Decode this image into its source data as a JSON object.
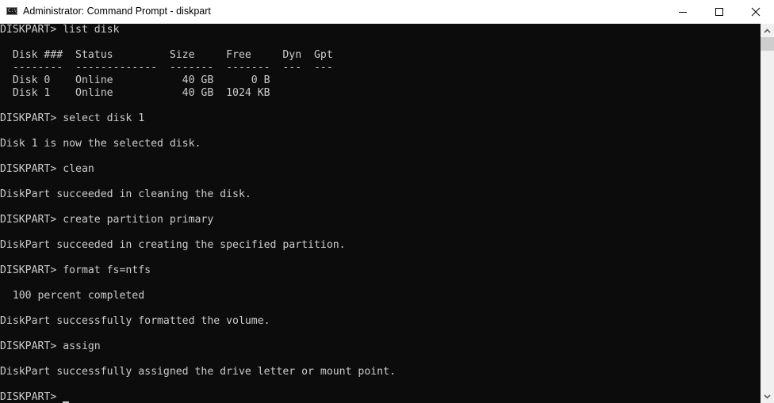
{
  "window": {
    "title": "Administrator: Command Prompt - diskpart",
    "icon": "cmd-icon",
    "icon_text": "C:\\.",
    "controls": [
      "minimize-icon",
      "maximize-icon",
      "close-icon"
    ]
  },
  "console": {
    "background": "#0c0c0c",
    "foreground": "#cccccc",
    "lines": [
      "DISKPART> list disk",
      "",
      "  Disk ###  Status         Size     Free     Dyn  Gpt",
      "  --------  -------------  -------  -------  ---  ---",
      "  Disk 0    Online           40 GB      0 B",
      "  Disk 1    Online           40 GB  1024 KB",
      "",
      "DISKPART> select disk 1",
      "",
      "Disk 1 is now the selected disk.",
      "",
      "DISKPART> clean",
      "",
      "DiskPart succeeded in cleaning the disk.",
      "",
      "DISKPART> create partition primary",
      "",
      "DiskPart succeeded in creating the specified partition.",
      "",
      "DISKPART> format fs=ntfs",
      "",
      "  100 percent completed",
      "",
      "DiskPart successfully formatted the volume.",
      "",
      "DISKPART> assign",
      "",
      "DiskPart successfully assigned the drive letter or mount point.",
      ""
    ],
    "prompt": "DISKPART> "
  },
  "scrollbar": {
    "up_icon": "scroll-up-arrow-icon",
    "down_icon": "scroll-down-arrow-icon"
  }
}
